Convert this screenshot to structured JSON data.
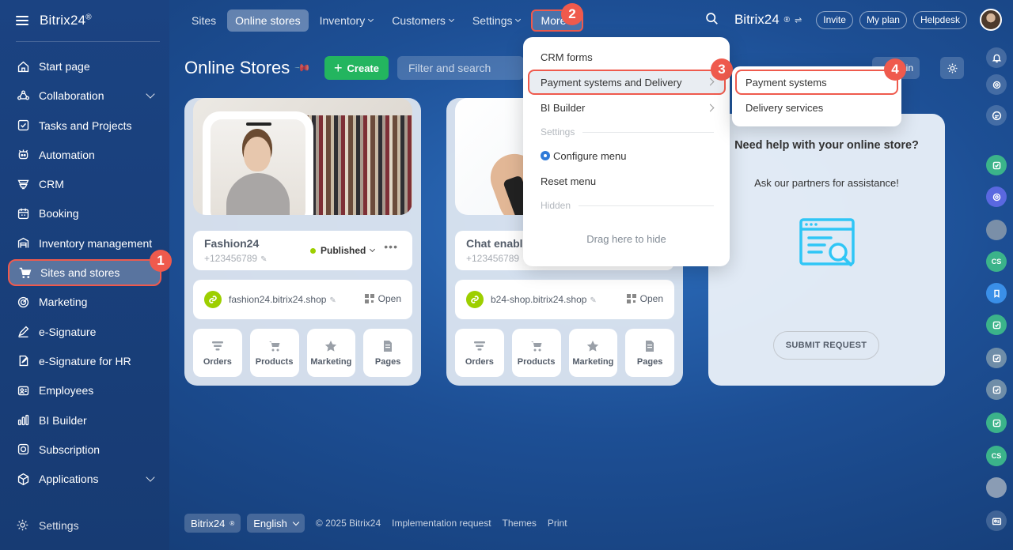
{
  "app": {
    "brand": "Bitrix24",
    "brand_mark": "®"
  },
  "sidebar": {
    "items": [
      {
        "label": "Start page",
        "icon": "home-icon"
      },
      {
        "label": "Collaboration",
        "icon": "collaboration-icon",
        "expandable": true
      },
      {
        "label": "Tasks and Projects",
        "icon": "tasks-icon"
      },
      {
        "label": "Automation",
        "icon": "automation-icon"
      },
      {
        "label": "CRM",
        "icon": "crm-icon"
      },
      {
        "label": "Booking",
        "icon": "booking-icon"
      },
      {
        "label": "Inventory management",
        "icon": "inventory-icon"
      },
      {
        "label": "Sites and stores",
        "icon": "cart-icon",
        "active": true
      },
      {
        "label": "Marketing",
        "icon": "marketing-icon"
      },
      {
        "label": "e-Signature",
        "icon": "signature-icon"
      },
      {
        "label": "e-Signature for HR",
        "icon": "hr-signature-icon"
      },
      {
        "label": "Employees",
        "icon": "employees-icon"
      },
      {
        "label": "BI Builder",
        "icon": "bi-builder-icon"
      },
      {
        "label": "Subscription",
        "icon": "subscription-icon"
      },
      {
        "label": "Applications",
        "icon": "applications-icon",
        "expandable": true
      }
    ],
    "settings_label": "Settings"
  },
  "topnav": {
    "items": [
      "Sites",
      "Online stores",
      "Inventory",
      "Customers",
      "Settings",
      "More"
    ],
    "selected": "Online stores"
  },
  "topright": {
    "brand": "Bitrix24",
    "invite": "Invite",
    "my_plan": "My plan",
    "helpdesk": "Helpdesk"
  },
  "page": {
    "title": "Online Stores",
    "create_label": "Create",
    "filter_placeholder": "Filter and search",
    "bin_label": "bin"
  },
  "cards": [
    {
      "name": "Fashion24",
      "phone": "+123456789",
      "status": "Published",
      "domain": "fashion24.bitrix24.shop",
      "open_label": "Open"
    },
    {
      "name": "Chat enable",
      "phone": "+123456789",
      "domain": "b24-shop.bitrix24.shop",
      "open_label": "Open"
    }
  ],
  "tiles": [
    "Orders",
    "Products",
    "Marketing",
    "Pages"
  ],
  "help": {
    "title": "Need help with your online store?",
    "subtitle": "Ask our partners for assistance!",
    "button": "SUBMIT REQUEST"
  },
  "more_menu": {
    "crm_forms": "CRM forms",
    "payment_delivery": "Payment systems and Delivery",
    "bi_builder": "BI Builder",
    "settings_header": "Settings",
    "configure_menu": "Configure menu",
    "reset_menu": "Reset menu",
    "hidden_header": "Hidden",
    "drag_hint": "Drag here to hide"
  },
  "sub_menu": {
    "payment_systems": "Payment systems",
    "delivery_services": "Delivery services"
  },
  "badges": [
    "1",
    "2",
    "3",
    "4"
  ],
  "footer": {
    "brand": "Bitrix24",
    "language": "English",
    "copyright": "© 2025 Bitrix24",
    "implementation": "Implementation request",
    "themes": "Themes",
    "print": "Print"
  },
  "colors": {
    "accent_green": "#23b55f",
    "highlight_red": "#ef5a4d",
    "status_green": "#9dcf00"
  }
}
